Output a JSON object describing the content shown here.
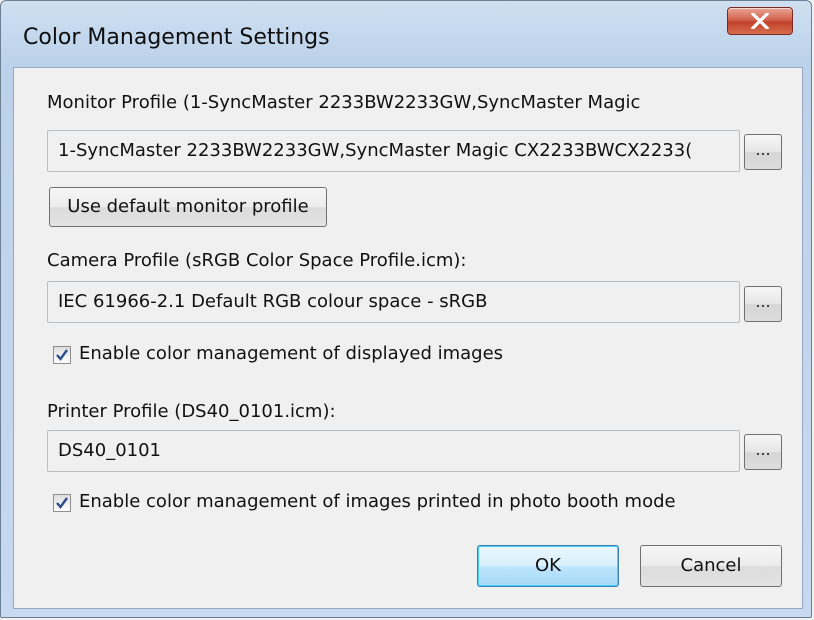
{
  "window": {
    "title": "Color Management Settings",
    "close_icon": "close-x-icon"
  },
  "monitor": {
    "label": "Monitor Profile (1-SyncMaster 2233BW2233GW,SyncMaster Magic",
    "value": "1-SyncMaster 2233BW2233GW,SyncMaster Magic CX2233BWCX2233(",
    "browse_label": "...",
    "default_button_label": "Use default monitor profile"
  },
  "camera": {
    "label": "Camera Profile (sRGB Color Space Profile.icm):",
    "value": "IEC 61966-2.1 Default RGB colour space - sRGB",
    "browse_label": "...",
    "enable_label": "Enable color management of displayed images",
    "enable_checked": true
  },
  "printer": {
    "label": "Printer Profile (DS40_0101.icm):",
    "value": "DS40_0101",
    "browse_label": "...",
    "enable_label": "Enable color management of images printed in photo booth mode",
    "enable_checked": true
  },
  "buttons": {
    "ok_label": "OK",
    "cancel_label": "Cancel"
  },
  "colors": {
    "close_button": "#c2432c",
    "default_button_border": "#3c7fb1",
    "check_mark": "#2a4c8c"
  }
}
